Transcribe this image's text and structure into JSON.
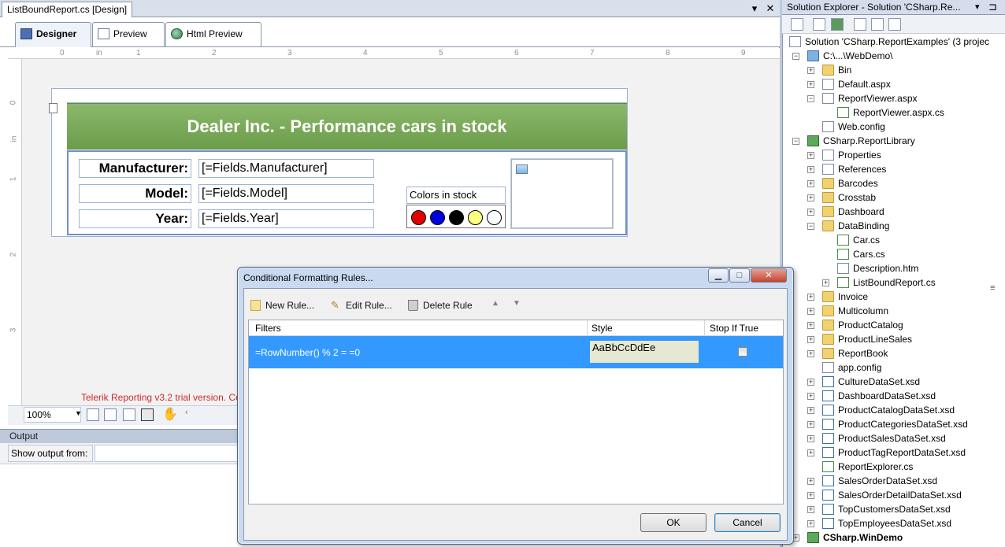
{
  "document": {
    "tab_title": "ListBoundReport.cs [Design]",
    "designer_tabs": [
      "Designer",
      "Preview",
      "Html Preview"
    ],
    "ruler_top": [
      "0",
      "in",
      "1",
      "2",
      "3",
      "4",
      "5",
      "6",
      "7",
      "8",
      "9"
    ],
    "ruler_left": [
      "0",
      "in",
      "1",
      "2",
      "3"
    ],
    "report": {
      "title": "Dealer Inc. - Performance cars in stock",
      "labels": [
        "Manufacturer:",
        "Model:",
        "Year:"
      ],
      "fields": [
        "[=Fields.Manufacturer]",
        "[=Fields.Model]",
        "[=Fields.Year]"
      ],
      "colors_label": "Colors in stock",
      "colors": [
        "#e00000",
        "#0000dd",
        "#000000",
        "#ffff80",
        "#ffffff"
      ]
    },
    "trial_text": "Telerik Reporting v3.2 trial version. Co",
    "zoom": "100%"
  },
  "output": {
    "title": "Output",
    "show_output_from": "Show output from:"
  },
  "solution_explorer": {
    "title": "Solution Explorer - Solution 'CSharp.Re...",
    "items": [
      {
        "label": "Solution 'CSharp.ReportExamples' (3 projec",
        "depth": 0,
        "icon": "solution",
        "exp": ""
      },
      {
        "label": "C:\\...\\WebDemo\\",
        "depth": 1,
        "icon": "web",
        "exp": "-"
      },
      {
        "label": "Bin",
        "depth": 2,
        "icon": "folder",
        "exp": "+"
      },
      {
        "label": "Default.aspx",
        "depth": 2,
        "icon": "file",
        "exp": "+"
      },
      {
        "label": "ReportViewer.aspx",
        "depth": 2,
        "icon": "file",
        "exp": "-"
      },
      {
        "label": "ReportViewer.aspx.cs",
        "depth": 3,
        "icon": "cs",
        "exp": ""
      },
      {
        "label": "Web.config",
        "depth": 2,
        "icon": "file",
        "exp": ""
      },
      {
        "label": "CSharp.ReportLibrary",
        "depth": 1,
        "icon": "proj",
        "exp": "-"
      },
      {
        "label": "Properties",
        "depth": 2,
        "icon": "file",
        "exp": "+"
      },
      {
        "label": "References",
        "depth": 2,
        "icon": "file",
        "exp": "+"
      },
      {
        "label": "Barcodes",
        "depth": 2,
        "icon": "folder",
        "exp": "+"
      },
      {
        "label": "Crosstab",
        "depth": 2,
        "icon": "folder",
        "exp": "+"
      },
      {
        "label": "Dashboard",
        "depth": 2,
        "icon": "folder",
        "exp": "+"
      },
      {
        "label": "DataBinding",
        "depth": 2,
        "icon": "folder",
        "exp": "-"
      },
      {
        "label": "Car.cs",
        "depth": 3,
        "icon": "cs",
        "exp": ""
      },
      {
        "label": "Cars.cs",
        "depth": 3,
        "icon": "cs",
        "exp": ""
      },
      {
        "label": "Description.htm",
        "depth": 3,
        "icon": "file",
        "exp": ""
      },
      {
        "label": "ListBoundReport.cs",
        "depth": 3,
        "icon": "cs",
        "exp": "+"
      },
      {
        "label": "Invoice",
        "depth": 2,
        "icon": "folder",
        "exp": "+"
      },
      {
        "label": "Multicolumn",
        "depth": 2,
        "icon": "folder",
        "exp": "+"
      },
      {
        "label": "ProductCatalog",
        "depth": 2,
        "icon": "folder",
        "exp": "+"
      },
      {
        "label": "ProductLineSales",
        "depth": 2,
        "icon": "folder",
        "exp": "+"
      },
      {
        "label": "ReportBook",
        "depth": 2,
        "icon": "folder",
        "exp": "+"
      },
      {
        "label": "app.config",
        "depth": 2,
        "icon": "file",
        "exp": ""
      },
      {
        "label": "CultureDataSet.xsd",
        "depth": 2,
        "icon": "xsd",
        "exp": "+"
      },
      {
        "label": "DashboardDataSet.xsd",
        "depth": 2,
        "icon": "xsd",
        "exp": "+"
      },
      {
        "label": "ProductCatalogDataSet.xsd",
        "depth": 2,
        "icon": "xsd",
        "exp": "+"
      },
      {
        "label": "ProductCategoriesDataSet.xsd",
        "depth": 2,
        "icon": "xsd",
        "exp": "+"
      },
      {
        "label": "ProductSalesDataSet.xsd",
        "depth": 2,
        "icon": "xsd",
        "exp": "+"
      },
      {
        "label": "ProductTagReportDataSet.xsd",
        "depth": 2,
        "icon": "xsd",
        "exp": "+"
      },
      {
        "label": "ReportExplorer.cs",
        "depth": 2,
        "icon": "cs",
        "exp": ""
      },
      {
        "label": "SalesOrderDataSet.xsd",
        "depth": 2,
        "icon": "xsd",
        "exp": "+"
      },
      {
        "label": "SalesOrderDetailDataSet.xsd",
        "depth": 2,
        "icon": "xsd",
        "exp": "+"
      },
      {
        "label": "TopCustomersDataSet.xsd",
        "depth": 2,
        "icon": "xsd",
        "exp": "+"
      },
      {
        "label": "TopEmployeesDataSet.xsd",
        "depth": 2,
        "icon": "xsd",
        "exp": "+"
      },
      {
        "label": "CSharp.WinDemo",
        "depth": 1,
        "icon": "proj",
        "exp": "+",
        "bold": true
      }
    ]
  },
  "dialog": {
    "title": "Conditional Formatting Rules...",
    "toolbar": {
      "new_rule": "New Rule...",
      "edit_rule": "Edit Rule...",
      "delete_rule": "Delete Rule"
    },
    "columns": [
      "Filters",
      "Style",
      "Stop If True"
    ],
    "rows": [
      {
        "filter": "=RowNumber() % 2 = =0",
        "style": "AaBbCcDdEe",
        "stop_if_true": false
      }
    ],
    "ok": "OK",
    "cancel": "Cancel"
  }
}
